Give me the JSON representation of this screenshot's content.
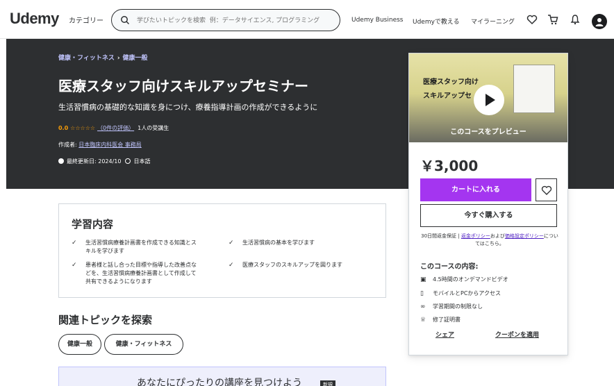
{
  "nav": {
    "logo": "Udemy",
    "categories": "カテゴリー",
    "search_placeholder": "学びたいトピックを検索  例：データサイエンス, プログラミング",
    "business": "Udemy Business",
    "teach": "Udemyで教える",
    "my_learning": "マイラーニング"
  },
  "hero": {
    "breadcrumb": [
      "健康・フィットネス",
      "健康一般"
    ],
    "breadcrumb_sep": "›",
    "title": "医療スタッフ向けスキルアップセミナー",
    "subtitle": "生活習慣病の基礎的な知識を身につけ、療養指導計画の作成ができるように",
    "rating": "0.0",
    "stars": "☆☆☆☆☆",
    "reviews": "（0件の評価）",
    "students": "1人の受講生",
    "author_prefix": "作成者: ",
    "author": "日本臨床内科医会 事務局",
    "updated": "最終更新日: 2024/10",
    "language": "日本語"
  },
  "card": {
    "preview_line1": "医療スタッフ向け",
    "preview_line2": "スキルアップセ",
    "preview_cta": "このコースをプレビュー",
    "price": "￥3,000",
    "add_to_cart": "カートに入れる",
    "buy_now": "今すぐ購入する",
    "guarantee_prefix": "30日間返金保証 | ",
    "refund_policy": "返金ポリシー",
    "and": "および",
    "pricing_policy": "価格設定ポリシー",
    "guarantee_suffix": "についてはこちら。",
    "includes_title": "このコースの内容:",
    "includes": [
      {
        "icon": "video-icon",
        "glyph": "▣",
        "text": "4.5時間のオンデマンドビデオ"
      },
      {
        "icon": "mobile-icon",
        "glyph": "▯",
        "text": "モバイルとPCからアクセス"
      },
      {
        "icon": "infinity-icon",
        "glyph": "∞",
        "text": "学習期間の制限なし"
      },
      {
        "icon": "trophy-icon",
        "glyph": "♕",
        "text": "修了証明書"
      }
    ],
    "share": "シェア",
    "coupon": "クーポンを適用"
  },
  "learn": {
    "title": "学習内容",
    "items": [
      "生活習慣病療養計画書を作成できる知識とス\nキルを学びます",
      "生活習慣病の基本を学びます",
      "患者様と話し合った目標や指導した改善点な\nどを、生活習慣病療養計画書として作成して\n共有できるようになります",
      "医療スタッフのスキルアップを図ります"
    ]
  },
  "related": {
    "title": "関連トピックを探索",
    "topics": [
      "健康一般",
      "健康・フィットネス"
    ]
  },
  "banner": {
    "text": "あなたにぴったりの講座を見つけよう",
    "badge": "新規"
  },
  "colors": {
    "brand_purple": "#a435f0",
    "hero_bg": "#2d2f31",
    "link": "#c0c4fc",
    "star": "#f69c08"
  }
}
